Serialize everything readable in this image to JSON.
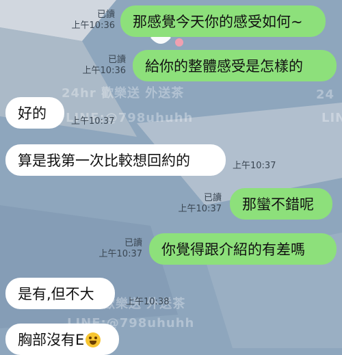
{
  "messages": [
    {
      "id": "m1",
      "side": "out",
      "text": "那感覺今天你的感受如何~",
      "read": "已讀",
      "time": "上午10:36"
    },
    {
      "id": "m2",
      "side": "out",
      "text": "給你的整體感受是怎樣的",
      "read": "已讀",
      "time": "上午10:36"
    },
    {
      "id": "m3",
      "side": "in",
      "text": "好的",
      "time": "上午10:37"
    },
    {
      "id": "m4",
      "side": "in",
      "text": "算是我第一次比較想回約的",
      "time": "上午10:37"
    },
    {
      "id": "m5",
      "side": "out",
      "text": "那蠻不錯呢",
      "read": "已讀",
      "time": "上午10:37"
    },
    {
      "id": "m6",
      "side": "out",
      "text": "你覺得跟介紹的有差嗎",
      "read": "已讀",
      "time": "上午10:37"
    },
    {
      "id": "m7",
      "side": "in",
      "text": "是有,但不大",
      "time": "上午10:38"
    },
    {
      "id": "m8",
      "side": "in",
      "text": "胸部沒有E",
      "emoji": "laughing-crying-face"
    }
  ],
  "watermarks": [
    "24hr 歡樂送 外送茶",
    "LINE:@798uhuhh",
    "24",
    "LIN",
    "24hr 歡樂送 外送茶",
    "LINE:@798uhuhh"
  ],
  "colors": {
    "background": "#8ea6bd",
    "outgoing": "#8de07b",
    "incoming": "#ffffff"
  }
}
